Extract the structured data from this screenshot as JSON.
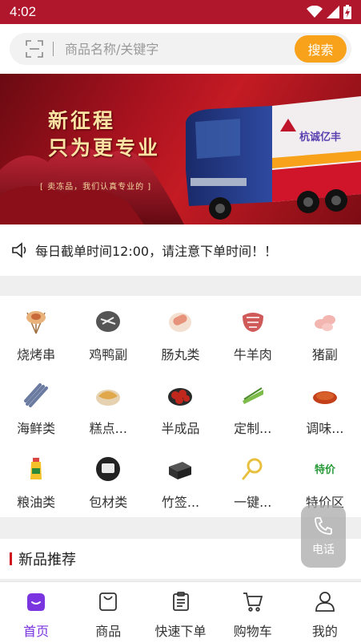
{
  "status_bar": {
    "time": "4:02"
  },
  "search": {
    "placeholder": "商品名称/关键字",
    "button_label": "搜索"
  },
  "banner": {
    "headline_1": "新征程",
    "headline_2": "只为更专业",
    "tagline": "[ 卖冻品，我们认真专业的 ]",
    "truck_brand": "杭诚亿丰"
  },
  "notice": {
    "text": "每日截单时间12:00，请注意下单时间！！"
  },
  "categories": [
    {
      "label": "烧烤串",
      "icon": "skewers-icon",
      "color": "#e8b27a"
    },
    {
      "label": "鸡鸭副",
      "icon": "poultry-icon",
      "color": "#555555"
    },
    {
      "label": "肠丸类",
      "icon": "sausage-icon",
      "color": "#e7927a"
    },
    {
      "label": "牛羊肉",
      "icon": "beef-icon",
      "color": "#d05a5a"
    },
    {
      "label": "猪副",
      "icon": "pork-icon",
      "color": "#f2b5b0"
    },
    {
      "label": "海鲜类",
      "icon": "seafood-icon",
      "color": "#6a7aa0"
    },
    {
      "label": "糕点...",
      "icon": "pastry-icon",
      "color": "#e0a84a"
    },
    {
      "label": "半成品",
      "icon": "semi-finished-icon",
      "color": "#c0281e"
    },
    {
      "label": "定制...",
      "icon": "custom-icon",
      "color": "#7dbb4a"
    },
    {
      "label": "调味...",
      "icon": "seasoning-icon",
      "color": "#c4401a"
    },
    {
      "label": "粮油类",
      "icon": "oil-icon",
      "color": "#f3c22a"
    },
    {
      "label": "包材类",
      "icon": "packaging-icon",
      "color": "#222222"
    },
    {
      "label": "竹签...",
      "icon": "bamboo-stick-icon",
      "color": "#333333"
    },
    {
      "label": "一键...",
      "icon": "magnifier-icon",
      "color": "#e8c040"
    },
    {
      "label": "特价区",
      "icon": "special-offer-icon",
      "color": "#2a9a3a"
    }
  ],
  "new_products": {
    "title": "新品推荐"
  },
  "float_call": {
    "label": "电话"
  },
  "tabs": [
    {
      "label": "首页",
      "icon": "home-icon",
      "active": true
    },
    {
      "label": "商品",
      "icon": "shopping-bag-icon",
      "active": false
    },
    {
      "label": "快速下单",
      "icon": "clipboard-icon",
      "active": false
    },
    {
      "label": "购物车",
      "icon": "cart-icon",
      "active": false
    },
    {
      "label": "我的",
      "icon": "user-icon",
      "active": false
    }
  ],
  "colors": {
    "brand_red": "#b0172d",
    "accent_orange": "#f7a21a",
    "active_tab": "#7a35e0"
  }
}
